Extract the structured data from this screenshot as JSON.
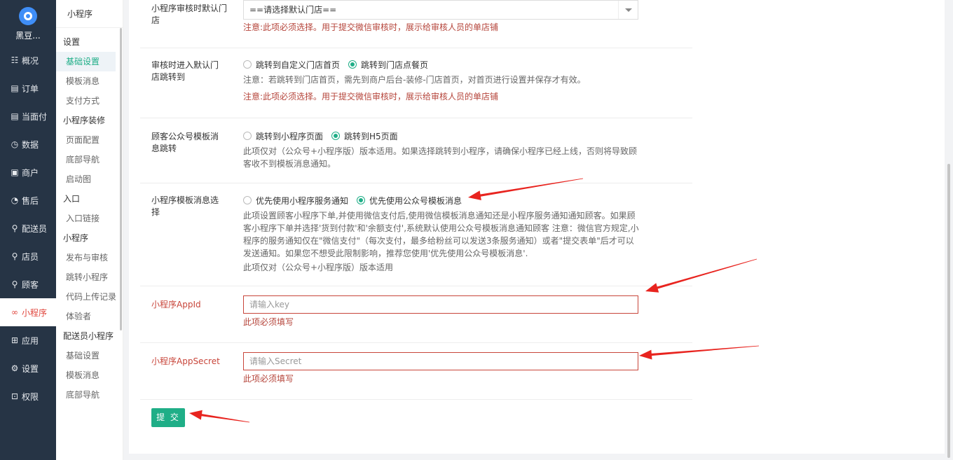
{
  "brand": {
    "name": "黑豆..."
  },
  "nav": [
    {
      "icon": "☷",
      "icon_name": "overview-icon",
      "label": "概况"
    },
    {
      "icon": "▤",
      "icon_name": "order-icon",
      "label": "订单"
    },
    {
      "icon": "▤",
      "icon_name": "face-pay-icon",
      "label": "当面付"
    },
    {
      "icon": "◷",
      "icon_name": "data-icon",
      "label": "数据"
    },
    {
      "icon": "▣",
      "icon_name": "shop-icon",
      "label": "商户"
    },
    {
      "icon": "◔",
      "icon_name": "after-sale-icon",
      "label": "售后"
    },
    {
      "icon": "⚲",
      "icon_name": "courier-icon",
      "label": "配送员"
    },
    {
      "icon": "⚲",
      "icon_name": "clerk-icon",
      "label": "店员"
    },
    {
      "icon": "⚲",
      "icon_name": "customer-icon",
      "label": "顾客"
    },
    {
      "icon": "∞",
      "icon_name": "mini-program-icon",
      "label": "小程序"
    },
    {
      "icon": "⊞",
      "icon_name": "apps-icon",
      "label": "应用"
    },
    {
      "icon": "⚙",
      "icon_name": "settings-icon",
      "label": "设置"
    },
    {
      "icon": "⊡",
      "icon_name": "permission-icon",
      "label": "权限"
    }
  ],
  "subnav": {
    "title": "小程序",
    "items": [
      {
        "kind": "group",
        "label": "设置"
      },
      {
        "kind": "link",
        "label": "基础设置",
        "active": true
      },
      {
        "kind": "link",
        "label": "模板消息"
      },
      {
        "kind": "link",
        "label": "支付方式"
      },
      {
        "kind": "group",
        "label": "小程序装修"
      },
      {
        "kind": "link",
        "label": "页面配置"
      },
      {
        "kind": "link",
        "label": "底部导航"
      },
      {
        "kind": "link",
        "label": "启动图"
      },
      {
        "kind": "group",
        "label": "入口"
      },
      {
        "kind": "link",
        "label": "入口链接"
      },
      {
        "kind": "group",
        "label": "小程序"
      },
      {
        "kind": "link",
        "label": "发布与审核"
      },
      {
        "kind": "link",
        "label": "跳转小程序"
      },
      {
        "kind": "link",
        "label": "代码上传记录"
      },
      {
        "kind": "link",
        "label": "体验者"
      },
      {
        "kind": "group",
        "label": "配送员小程序"
      },
      {
        "kind": "link",
        "label": "基础设置"
      },
      {
        "kind": "link",
        "label": "模板消息"
      },
      {
        "kind": "link",
        "label": "底部导航"
      }
    ]
  },
  "form": {
    "default_store": {
      "label": "小程序审核时默认门店",
      "select_value": "==请选择默认门店==",
      "note": "注意:此项必须选择。用于提交微信审核时，展示给审核人员的单店铺"
    },
    "review_redirect": {
      "label": "审核时进入默认门店跳转到",
      "options": [
        "跳转到自定义门店首页",
        "跳转到门店点餐页"
      ],
      "selected": 1,
      "note1": "注意：若跳转到门店首页，需先到商户后台-装修-门店首页，对首页进行设置并保存才有效。",
      "note2": "注意:此项必须选择。用于提交微信审核时，展示给审核人员的单店铺"
    },
    "oa_template_redirect": {
      "label": "顾客公众号模板消息跳转",
      "options": [
        "跳转到小程序页面",
        "跳转到H5页面"
      ],
      "selected": 1,
      "note": "此项仅对（公众号+小程序版）版本适用。如果选择跳转到小程序，请确保小程序已经上线，否则将导致顾客收不到模板消息通知。"
    },
    "template_choice": {
      "label": "小程序模板消息选择",
      "options": [
        "优先使用小程序服务通知",
        "优先使用公众号模板消息"
      ],
      "selected": 1,
      "note": "此项设置顾客小程序下单,并使用微信支付后,使用微信模板消息通知还是小程序服务通知通知顾客。如果顾客小程序下单并选择'货到付款'和'余额支付',系统默认使用公众号模板消息通知顾客 注意：微信官方规定,小程序的服务通知仅在\"微信支付\"（每次支付，最多给粉丝可以发送3条服务通知）或者\"提交表单\"后才可以发送通知。如果您不想受此限制影响，推荐您使用'优先使用公众号模板消息'.",
      "note2": "此项仅对（公众号+小程序版）版本适用"
    },
    "appid": {
      "label": "小程序AppId",
      "placeholder": "请输入key",
      "error": "此项必须填写"
    },
    "appsecret": {
      "label": "小程序AppSecret",
      "placeholder": "请输入Secret",
      "error": "此项必须填写"
    },
    "submit": "提 交"
  },
  "colors": {
    "accent": "#1fae87",
    "error": "#c8453a",
    "nav_bg": "#263445",
    "annotation_arrow": "#e8241f"
  }
}
